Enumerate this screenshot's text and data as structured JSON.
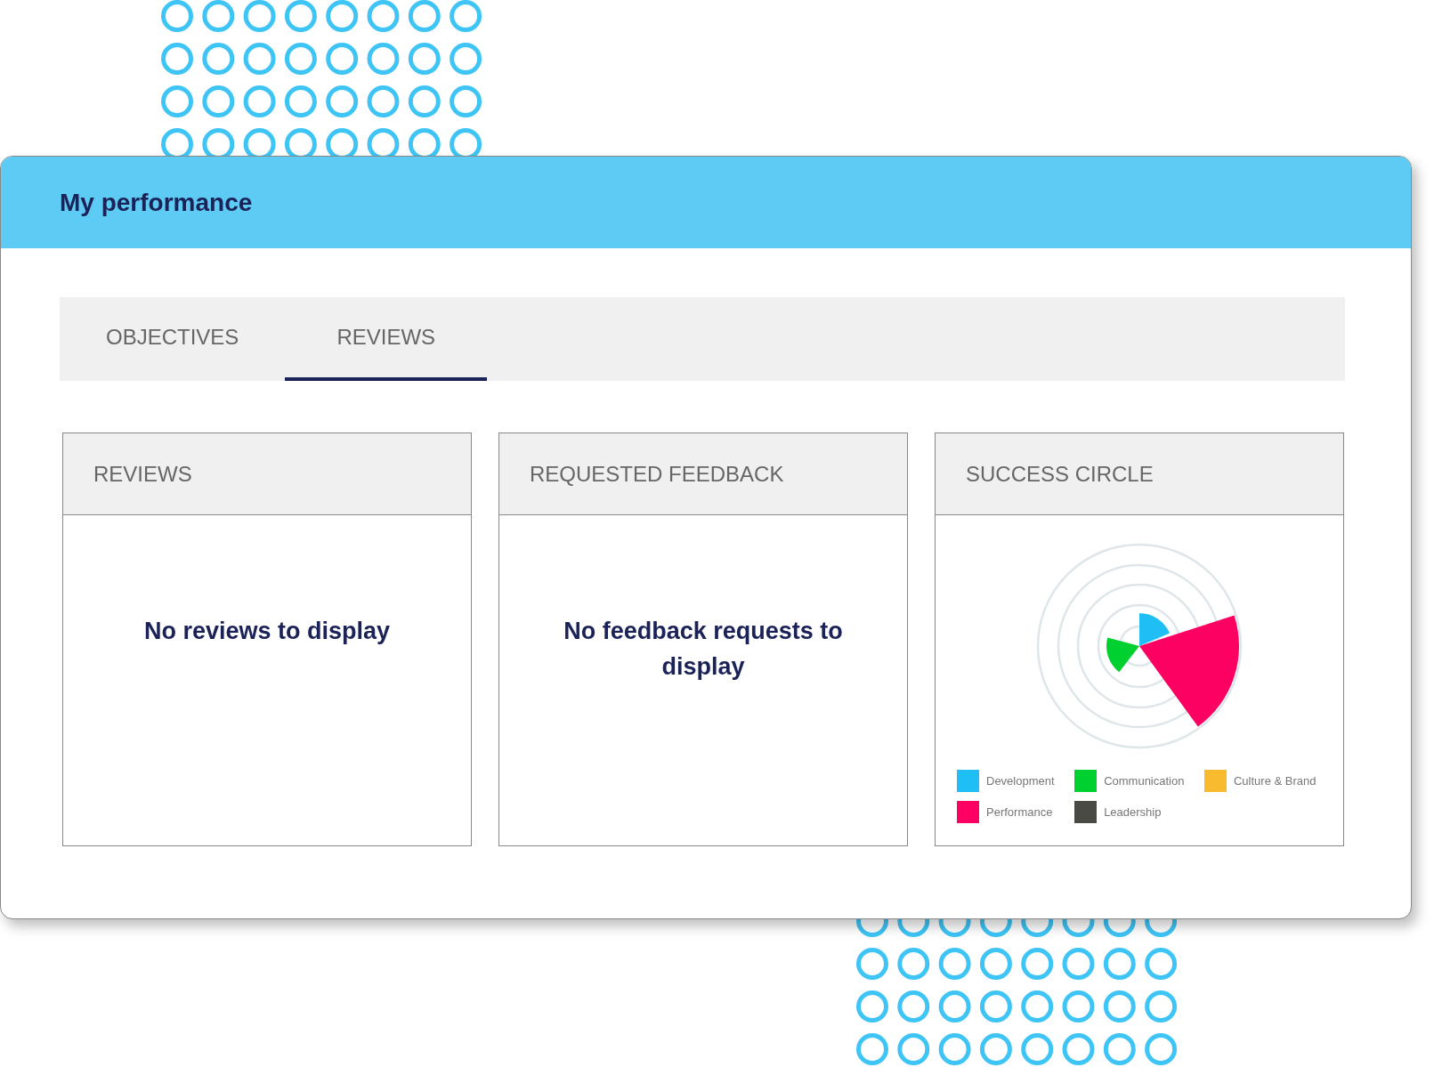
{
  "window": {
    "title": "My performance"
  },
  "tabs": [
    {
      "label": "OBJECTIVES",
      "selected": false
    },
    {
      "label": "REVIEWS",
      "selected": true
    }
  ],
  "panels": [
    {
      "kind": "message",
      "title": "REVIEWS",
      "message": "No reviews to display"
    },
    {
      "kind": "message",
      "title": "REQUESTED FEEDBACK",
      "message": "No feedback requests to display"
    },
    {
      "kind": "chart",
      "title": "SUCCESS CIRCLE",
      "legend": [
        {
          "label": "Development",
          "color": "#1fbff5"
        },
        {
          "label": "Communication",
          "color": "#00d130"
        },
        {
          "label": "Culture & Brand",
          "color": "#f8bb30"
        },
        {
          "label": "Performance",
          "color": "#fc0062"
        },
        {
          "label": "Leadership",
          "color": "#4a4a44"
        }
      ]
    }
  ]
}
